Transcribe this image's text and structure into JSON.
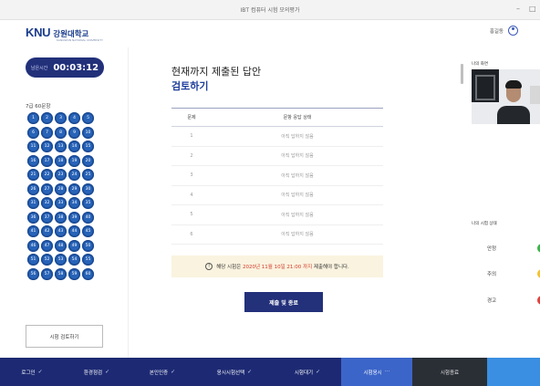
{
  "window": {
    "title": "IBT 컴퓨터 시험 모의평가"
  },
  "header": {
    "logo_text": "KNU",
    "logo_name": "강원대학교",
    "logo_sub": "KANGWON NATIONAL UNIVERSITY",
    "user_name": "홍길동"
  },
  "timer": {
    "label": "남은시간",
    "value": "00:03:12"
  },
  "questions": {
    "count_label": "7급 60문항",
    "numbers": [
      "1",
      "2",
      "3",
      "4",
      "5",
      "6",
      "7",
      "8",
      "9",
      "10",
      "11",
      "12",
      "13",
      "14",
      "15",
      "16",
      "17",
      "18",
      "19",
      "20",
      "21",
      "22",
      "23",
      "24",
      "25",
      "26",
      "27",
      "28",
      "29",
      "30",
      "31",
      "32",
      "33",
      "34",
      "35",
      "36",
      "37",
      "38",
      "39",
      "40",
      "41",
      "42",
      "43",
      "44",
      "45",
      "46",
      "47",
      "48",
      "49",
      "50",
      "51",
      "52",
      "53",
      "54",
      "55",
      "56",
      "57",
      "58",
      "59",
      "60"
    ],
    "review_button": "시험 검토하기"
  },
  "main": {
    "title": "현재까지 제출된 답안",
    "subtitle": "검토하기",
    "table": {
      "headers": [
        "문제",
        "문항 응답 상태"
      ],
      "rows": [
        {
          "num": "1",
          "status": "아직 답하지 않음"
        },
        {
          "num": "2",
          "status": "아직 답하지 않음"
        },
        {
          "num": "3",
          "status": "아직 답하지 않음"
        },
        {
          "num": "4",
          "status": "아직 답하지 않음"
        },
        {
          "num": "5",
          "status": "아직 답하지 않음"
        },
        {
          "num": "6",
          "status": "아직 답하지 않음"
        }
      ]
    },
    "notice": {
      "icon": "!",
      "prefix": "해당 시험은",
      "deadline": "2020년 11월 10일 21:00 까지",
      "suffix": "제출해야 합니다."
    },
    "submit_button": "제출 및 종료"
  },
  "right_panel": {
    "camera_label": "나의 화면",
    "status_label": "나의 시험 상태",
    "statuses": [
      {
        "label": "안정",
        "color": "#3cb34a"
      },
      {
        "label": "주의",
        "color": "#f2c230"
      },
      {
        "label": "경고",
        "color": "#e2413b"
      }
    ]
  },
  "steps": [
    {
      "label": "로그인",
      "check": "✓",
      "state": "done"
    },
    {
      "label": "환경점검",
      "check": "✓",
      "state": "done"
    },
    {
      "label": "본인인증",
      "check": "✓",
      "state": "done"
    },
    {
      "label": "응시시험선택",
      "check": "✓",
      "state": "done"
    },
    {
      "label": "시험대기",
      "check": "✓",
      "state": "done"
    },
    {
      "label": "시험응시",
      "check": "···",
      "state": "active"
    },
    {
      "label": "시험종료",
      "check": "",
      "state": "pending"
    }
  ],
  "colors": {
    "brand": "#1f3f9c",
    "navy": "#22307a",
    "question_button": "#2763b8",
    "active_step": "#3b65c8",
    "deadline_red": "#d23a2a",
    "notice_bg": "#faf3df"
  }
}
